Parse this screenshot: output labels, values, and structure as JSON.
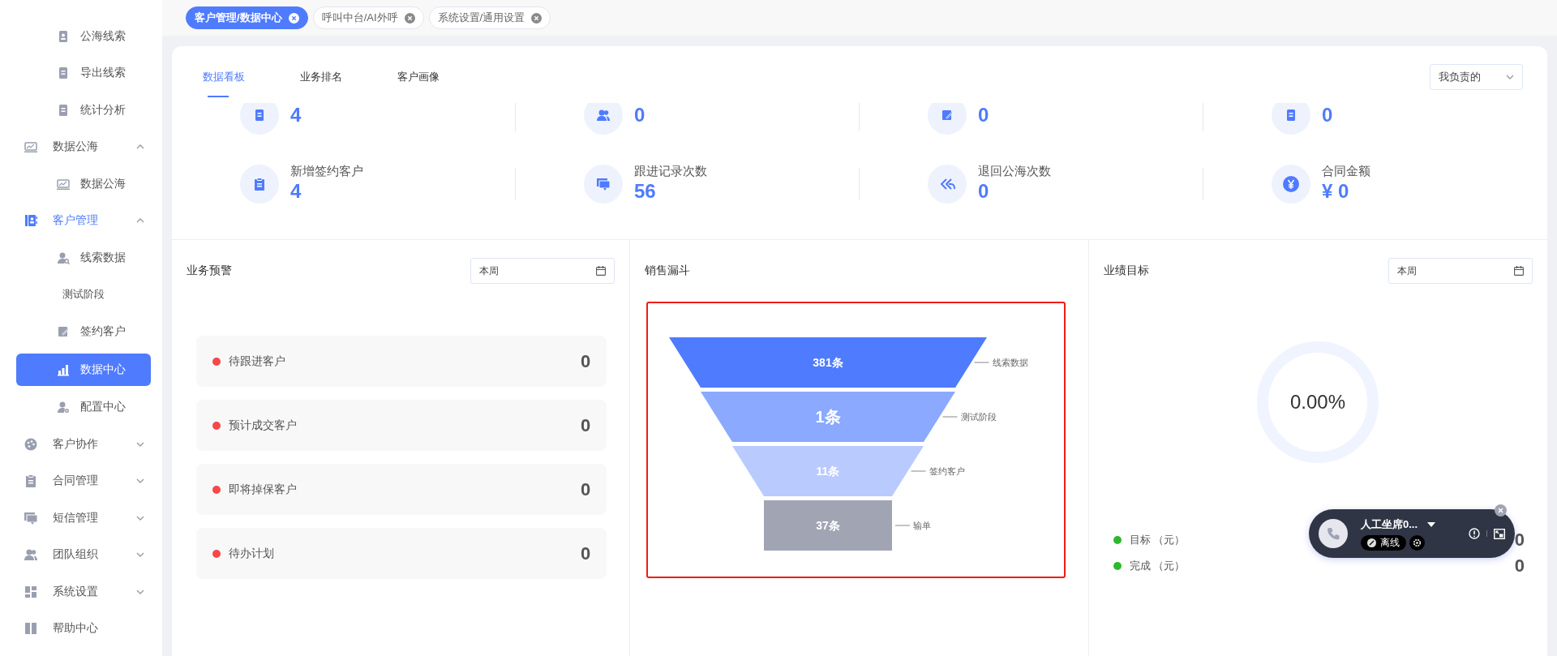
{
  "sidebar": {
    "scrolled_children": [
      {
        "label": "公海线索",
        "selected": false
      },
      {
        "label": "导出线索",
        "selected": false
      },
      {
        "label": "统计分析",
        "selected": false
      }
    ],
    "items": [
      {
        "label": "数据公海",
        "selected": false,
        "expanded": true,
        "children": [
          {
            "label": "数据公海",
            "selected": false
          }
        ]
      },
      {
        "label": "客户管理",
        "selected": true,
        "expanded": true,
        "children": [
          {
            "label": "线索数据",
            "selected": false
          },
          {
            "label": "测试阶段",
            "selected": false
          },
          {
            "label": "签约客户",
            "selected": false
          },
          {
            "label": "数据中心",
            "selected": true
          },
          {
            "label": "配置中心",
            "selected": false
          }
        ]
      },
      {
        "label": "客户协作",
        "selected": false,
        "expanded": false
      },
      {
        "label": "合同管理",
        "selected": false,
        "expanded": false
      },
      {
        "label": "短信管理",
        "selected": false,
        "expanded": false
      },
      {
        "label": "团队组织",
        "selected": false,
        "expanded": false
      },
      {
        "label": "系统设置",
        "selected": false,
        "expanded": false
      },
      {
        "label": "帮助中心",
        "selected": false
      }
    ]
  },
  "open_tabs": [
    {
      "label": "客户管理/数据中心",
      "selected": true
    },
    {
      "label": "呼叫中台/AI外呼",
      "selected": false
    },
    {
      "label": "系统设置/通用设置",
      "selected": false
    }
  ],
  "page_tabs": [
    {
      "label": "数据看板",
      "selected": true
    },
    {
      "label": "业务排名",
      "selected": false
    },
    {
      "label": "客户画像",
      "selected": false
    }
  ],
  "scope_select": {
    "value": "我负责的"
  },
  "stats_top_row": [
    {
      "value": "4"
    },
    {
      "value": "0"
    },
    {
      "value": "0"
    },
    {
      "value": "0"
    }
  ],
  "stats": [
    {
      "label": "新增签约客户",
      "value": "4"
    },
    {
      "label": "跟进记录次数",
      "value": "56"
    },
    {
      "label": "退回公海次数",
      "value": "0"
    },
    {
      "label": "合同金额",
      "value": "¥ 0"
    }
  ],
  "alerts": {
    "title": "业务预警",
    "date_field": {
      "value": "本周"
    },
    "rows": [
      {
        "label": "待跟进客户",
        "value": "0",
        "color": "#f5484a"
      },
      {
        "label": "预计成交客户",
        "value": "0",
        "color": "#f5484a"
      },
      {
        "label": "即将掉保客户",
        "value": "0",
        "color": "#f5484a"
      },
      {
        "label": "待办计划",
        "value": "0",
        "color": "#f5484a"
      }
    ]
  },
  "funnel": {
    "title": "销售漏斗",
    "stages": [
      {
        "name": "线索数据",
        "count": "381条",
        "color": "#4f7bff"
      },
      {
        "name": "测试阶段",
        "count": "1条",
        "color": "#8aa9ff"
      },
      {
        "name": "签约客户",
        "count": "11条",
        "color": "#b9caff"
      },
      {
        "name": "输单",
        "count": "37条",
        "color": "#a1a4b3"
      }
    ]
  },
  "goals": {
    "title": "业绩目标",
    "date_field": {
      "value": "本周"
    },
    "percent": "0.00%",
    "legend": [
      {
        "label": "目标 （元）",
        "value": "0",
        "color": "#2eb82e"
      },
      {
        "label": "完成 （元）",
        "value": "0",
        "color": "#2eb82e"
      }
    ]
  },
  "call_widget": {
    "agent": "人工坐席0...",
    "status": "离线"
  }
}
